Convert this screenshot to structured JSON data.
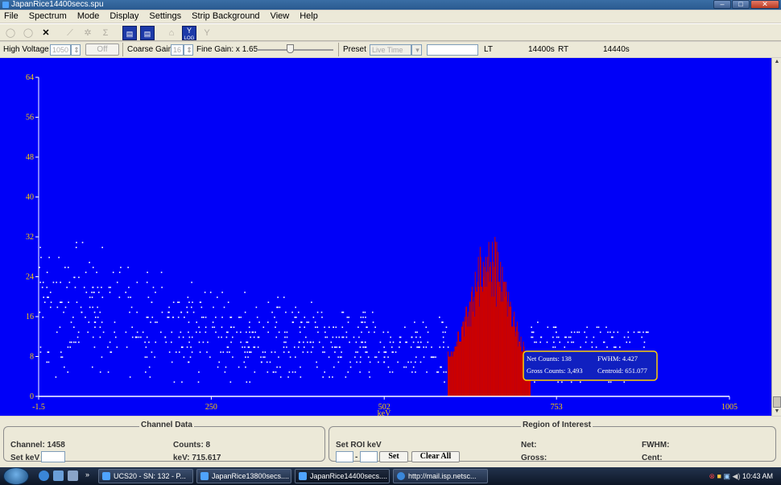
{
  "window": {
    "title": "JapanRice14400secs.spu"
  },
  "menu": [
    "File",
    "Spectrum",
    "Mode",
    "Display",
    "Settings",
    "Strip Background",
    "View",
    "Help"
  ],
  "toolbar": {
    "close_glyph": "✕",
    "log_label": "LOG",
    "icons": [
      "zoom-in-icon",
      "zoom-out-icon",
      "close-icon",
      "peak-icon",
      "roi-icon",
      "sum-icon",
      "report-icon",
      "print-icon",
      "home-icon",
      "log-scale-icon",
      "marker-icon"
    ]
  },
  "controls": {
    "hv_label": "High Voltage",
    "hv_value": "1050",
    "hv_toggle": "Off",
    "coarse_label": "Coarse Gain",
    "coarse_value": "16",
    "fine_label": "Fine Gain: x 1.65",
    "preset_label": "Preset",
    "preset_value": "Live Time",
    "preset_input": "",
    "lt_label": "LT",
    "lt_value": "14400s",
    "rt_label": "RT",
    "rt_value": "14440s"
  },
  "tooltip": {
    "net": "Net Counts: 138",
    "fwhm": "FWHM: 4.427",
    "gross": "Gross Counts: 3,493",
    "centroid": "Centroid: 651.077"
  },
  "colors": {
    "plot_bg": "#0000f8",
    "points": "#ffffff",
    "roi": "#cc0000",
    "tooltip_border": "#ffd000"
  },
  "chart_data": {
    "type": "scatter",
    "xlabel": "keV",
    "x_ticks": [
      "-1.5",
      "250",
      "502",
      "753",
      "1005"
    ],
    "y_ticks": [
      "0",
      "8",
      "16",
      "24",
      "32",
      "40",
      "48",
      "56",
      "64"
    ],
    "xlim": [
      -1.5,
      1005
    ],
    "ylim": [
      0,
      64
    ],
    "roi_kev": [
      595,
      715
    ],
    "roi_peak_counts": 35,
    "background_level_counts": 8
  },
  "channel_data": {
    "title": "Channel Data",
    "channel": "Channel: 1458",
    "counts": "Counts: 8",
    "setkev": "Set keV",
    "kev": "keV: 715.617"
  },
  "roi": {
    "title": "Region of Interest",
    "set_label": "Set ROI keV",
    "dash": "-",
    "set_btn": "Set",
    "clear_btn": "Clear All",
    "net": "Net:",
    "gross": "Gross:",
    "fwhm": "FWHM:",
    "cent": "Cent:"
  },
  "taskbar": {
    "tasks": [
      "UCS20 - SN: 132 - P...",
      "JapanRice13800secs....",
      "JapanRice14400secs....",
      "http://mail.isp.netsc..."
    ],
    "overflow": "»",
    "time": "10:43 AM"
  }
}
